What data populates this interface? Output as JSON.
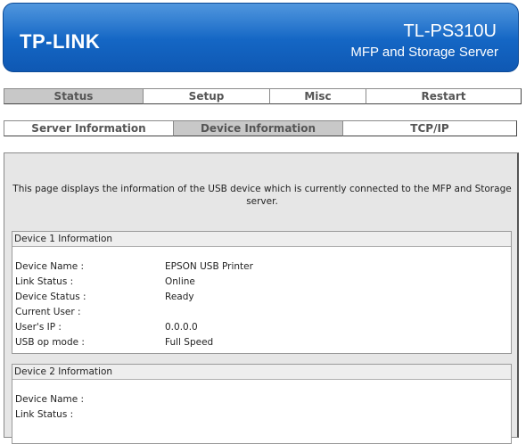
{
  "header": {
    "logo": "TP-LINK",
    "model": "TL-PS310U",
    "subtitle": "MFP and Storage Server"
  },
  "main_tabs": [
    {
      "label": "Status",
      "active": true
    },
    {
      "label": "Setup",
      "active": false
    },
    {
      "label": "Misc",
      "active": false
    },
    {
      "label": "Restart",
      "active": false
    }
  ],
  "sub_tabs": [
    {
      "label": "Server Information",
      "active": false
    },
    {
      "label": "Device Information",
      "active": true
    },
    {
      "label": "TCP/IP",
      "active": false
    }
  ],
  "description": "This page displays the information of the USB device which is currently connected to the MFP and Storage server.",
  "device1": {
    "title": "Device 1 Information",
    "rows": [
      {
        "label": "Device Name :",
        "value": "EPSON USB Printer"
      },
      {
        "label": "Link Status :",
        "value": "Online"
      },
      {
        "label": "Device Status :",
        "value": "Ready"
      },
      {
        "label": "Current User :",
        "value": ""
      },
      {
        "label": "User's IP :",
        "value": "0.0.0.0"
      },
      {
        "label": "USB op mode :",
        "value": "Full Speed"
      }
    ]
  },
  "device2": {
    "title": "Device 2 Information",
    "rows": [
      {
        "label": "Device Name :",
        "value": ""
      },
      {
        "label": "Link Status :",
        "value": ""
      }
    ]
  },
  "colors": {
    "header_blue": "#1466c4",
    "active_tab": "#c8c8c8",
    "content_bg": "#e6e6e6"
  }
}
